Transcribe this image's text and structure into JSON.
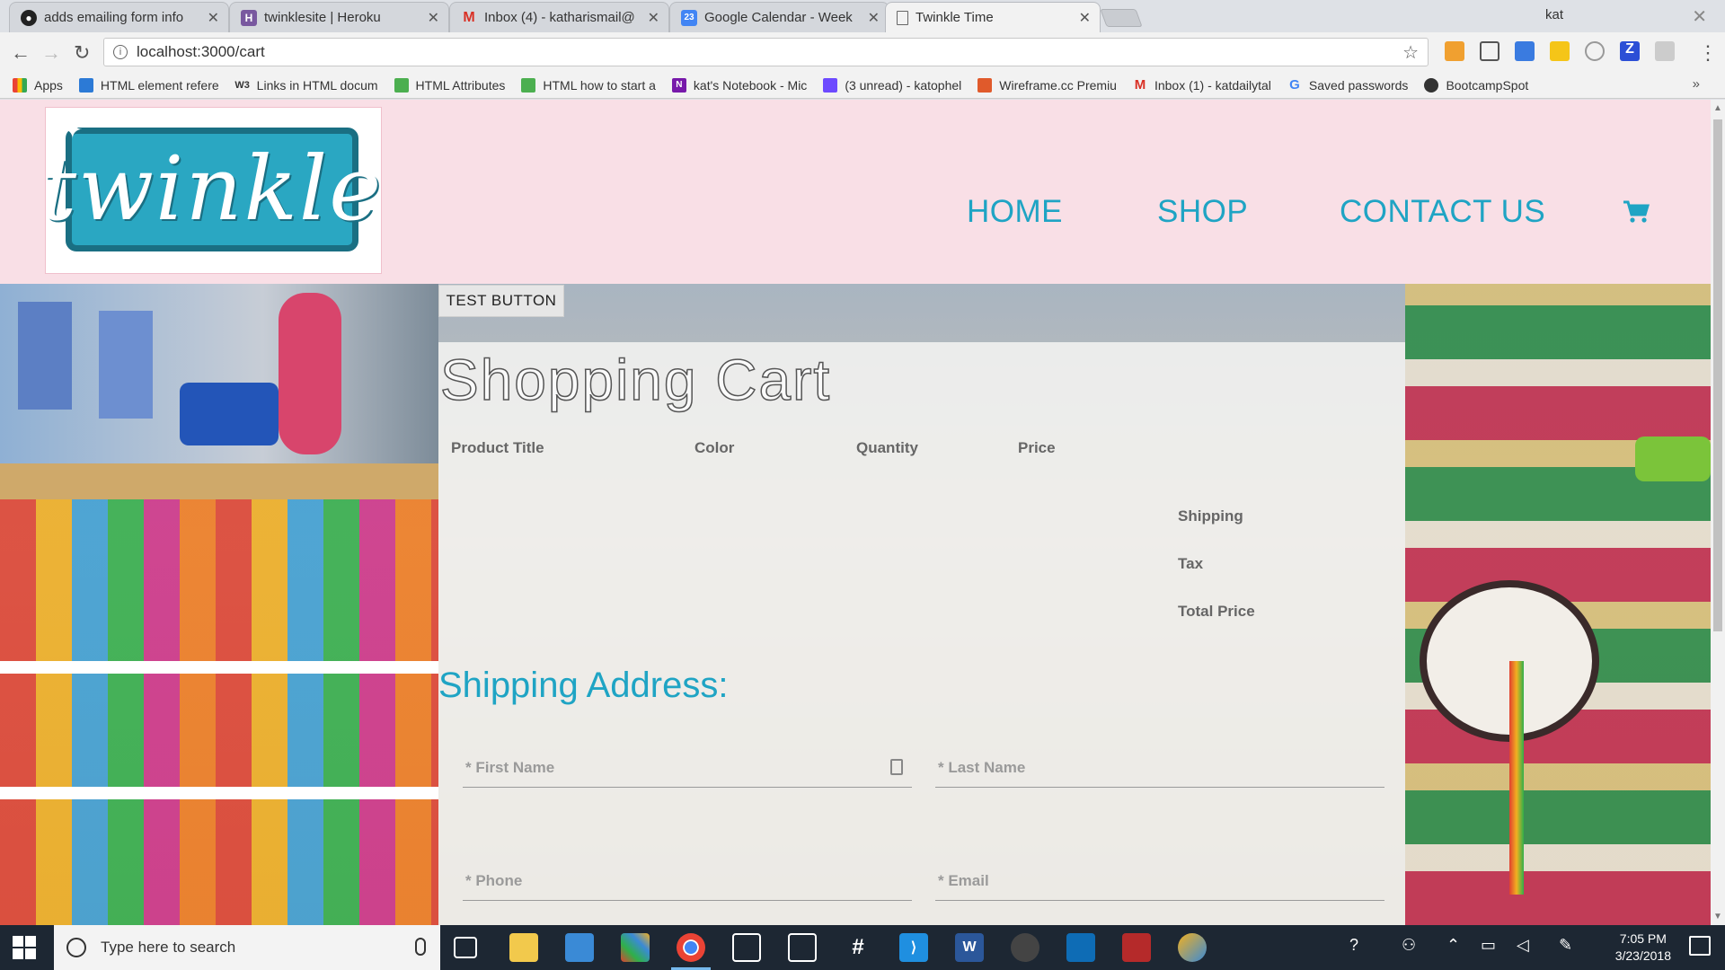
{
  "browser": {
    "tabs": [
      {
        "title": "adds emailing form info",
        "favicon": "github-icon",
        "color": "#333333"
      },
      {
        "title": "twinklesite | Heroku",
        "favicon": "heroku-icon",
        "color": "#79589f"
      },
      {
        "title": "Inbox (4) - katharismail@",
        "favicon": "gmail-icon",
        "color": "#d93025"
      },
      {
        "title": "Google Calendar - Week",
        "favicon": "calendar-icon",
        "color": "#4285f4",
        "badge": "23"
      },
      {
        "title": "Twinkle Time",
        "favicon": "page-icon",
        "color": "#ffffff"
      }
    ],
    "profile_name": "kat",
    "address": "localhost:3000/cart"
  },
  "bookmarks": [
    {
      "label": "Apps",
      "icon": "apps-grid-icon",
      "color": "#4285f4"
    },
    {
      "label": "HTML element refere",
      "icon": "page-icon",
      "color": "#2c7ad6"
    },
    {
      "label": "Links in HTML docum",
      "icon": "w3-icon",
      "color": "#333333",
      "badge": "W3"
    },
    {
      "label": "HTML Attributes",
      "icon": "w3schools-icon",
      "color": "#4caf50"
    },
    {
      "label": "HTML how to start a",
      "icon": "w3schools-icon",
      "color": "#4caf50"
    },
    {
      "label": "kat's Notebook - Mic",
      "icon": "onenote-icon",
      "color": "#7719aa",
      "badge": "N"
    },
    {
      "label": "(3 unread) - katophel",
      "icon": "mail-icon",
      "color": "#6d4aff"
    },
    {
      "label": "Wireframe.cc Premiu",
      "icon": "wireframe-icon",
      "color": "#e05a2b"
    },
    {
      "label": "Inbox (1) - katdailytal",
      "icon": "gmail-icon",
      "color": "#d93025"
    },
    {
      "label": "Saved passwords",
      "icon": "google-icon",
      "color": "#4285f4",
      "badge": "G"
    },
    {
      "label": "BootcampSpot",
      "icon": "github-icon",
      "color": "#333333"
    }
  ],
  "site": {
    "logo_text": "twinkle",
    "nav": [
      "HOME",
      "SHOP",
      "CONTACT US"
    ],
    "test_button": "TEST BUTTON",
    "cart_title": "Shopping Cart",
    "columns": [
      "Product Title",
      "Color",
      "Quantity",
      "Price"
    ],
    "summary": [
      "Shipping",
      "Tax",
      "Total Price"
    ],
    "shipping_heading": "Shipping Address:",
    "fields": {
      "first_name": "* First Name",
      "last_name": "* Last Name",
      "phone": "* Phone",
      "email": "* Email"
    },
    "accent": "#1fa4c4",
    "header_bg": "#f9dfe6"
  },
  "taskbar": {
    "search_placeholder": "Type here to search",
    "time": "7:05 PM",
    "date": "3/23/2018"
  }
}
